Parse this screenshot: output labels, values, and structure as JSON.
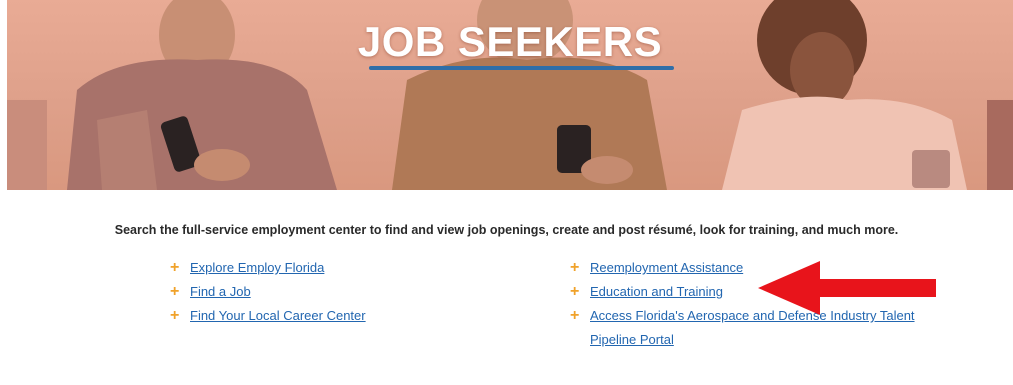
{
  "hero": {
    "title": "JOB SEEKERS",
    "accent_color": "#2f6ea8"
  },
  "intro_text": "Search the full-service employment center to find and view job openings, create and post résumé, look for training, and much more.",
  "links_left": [
    {
      "label": "Explore Employ Florida"
    },
    {
      "label": "Find a Job"
    },
    {
      "label": "Find Your Local Career Center"
    }
  ],
  "links_right": [
    {
      "label": "Reemployment Assistance"
    },
    {
      "label": "Education and Training"
    },
    {
      "label": "Access Florida's Aerospace and Defense Industry Talent Pipeline Portal"
    }
  ],
  "bullet_icon": "plus-icon",
  "bullet_color": "#f0a22a",
  "link_color": "#2266b0",
  "annotation": {
    "icon": "red-arrow-icon",
    "color": "#e8141b"
  }
}
